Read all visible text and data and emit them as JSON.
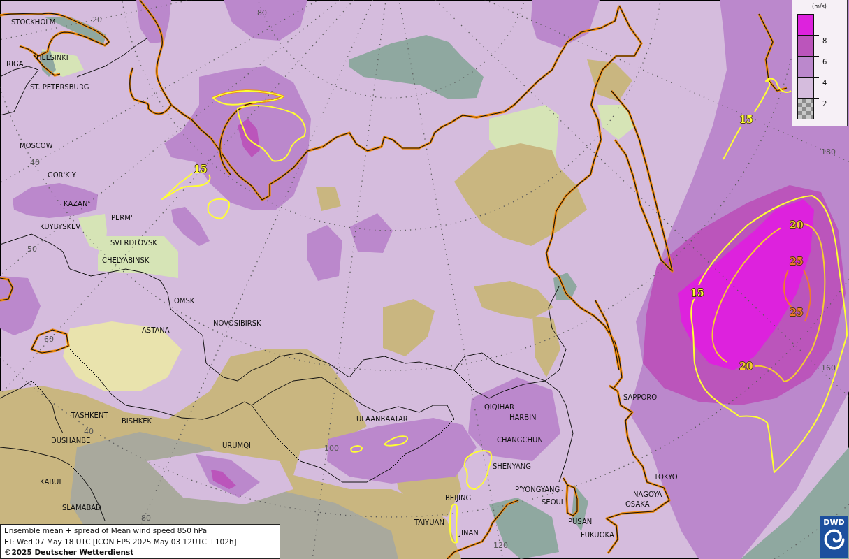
{
  "map": {
    "cities": [
      "STOCKHOLM",
      "HELSINKI",
      "RIGA",
      "ST. PETERSBURG",
      "MOSCOW",
      "GOR'KIY",
      "KAZAN'",
      "PERM'",
      "KUYBYSKEV",
      "SVERDLOVSK",
      "CHELYABINSK",
      "OMSK",
      "ASTANA",
      "NOVOSIBIRSK",
      "TASHKENT",
      "BISHKEK",
      "DUSHANBE",
      "URUMQI",
      "ULAANBAATAR",
      "KABUL",
      "ISLAMABAD",
      "QIQIHAR",
      "HARBIN",
      "CHANGCHUN",
      "SHENYANG",
      "BEIJING",
      "P'YONGYANG",
      "SEOUL",
      "TAIYUAN",
      "JINAN",
      "PUSAN",
      "FUKUOKA",
      "SAPPORO",
      "TOKYO",
      "NAGOYA",
      "OSAKA"
    ],
    "grid_labels": [
      "80",
      "20",
      "180",
      "40",
      "50",
      "60",
      "160",
      "40",
      "100",
      "80",
      "120"
    ],
    "isotachs": [
      {
        "color": "#ffff33",
        "labels": [
          "15",
          "15",
          "15"
        ]
      },
      {
        "color": "#f5cc30",
        "labels": [
          "20",
          "20"
        ]
      },
      {
        "color": "#f07830",
        "labels": [
          "25",
          "25"
        ]
      }
    ]
  },
  "legend": {
    "unit": "(m/s)",
    "bands": [
      {
        "kind": "solid",
        "color": "#dd22dd"
      },
      {
        "kind": "solid",
        "color": "#bb55bb"
      },
      {
        "kind": "solid",
        "color": "#bb88cc"
      },
      {
        "kind": "solid",
        "color": "#d5bcdd"
      },
      {
        "kind": "checker",
        "color": "#8c8c8c"
      }
    ],
    "ticks": [
      "8",
      "6",
      "4",
      "2"
    ]
  },
  "caption": {
    "lines": [
      "Ensemble mean + spread of Mean wind speed 850 hPa",
      "FT: Wed 07 May 18 UTC [ICON EPS 2025 May 03 12UTC +102h]"
    ],
    "credit": "©2025 Deutscher Wetterdienst"
  },
  "logo": {
    "text": "DWD"
  }
}
